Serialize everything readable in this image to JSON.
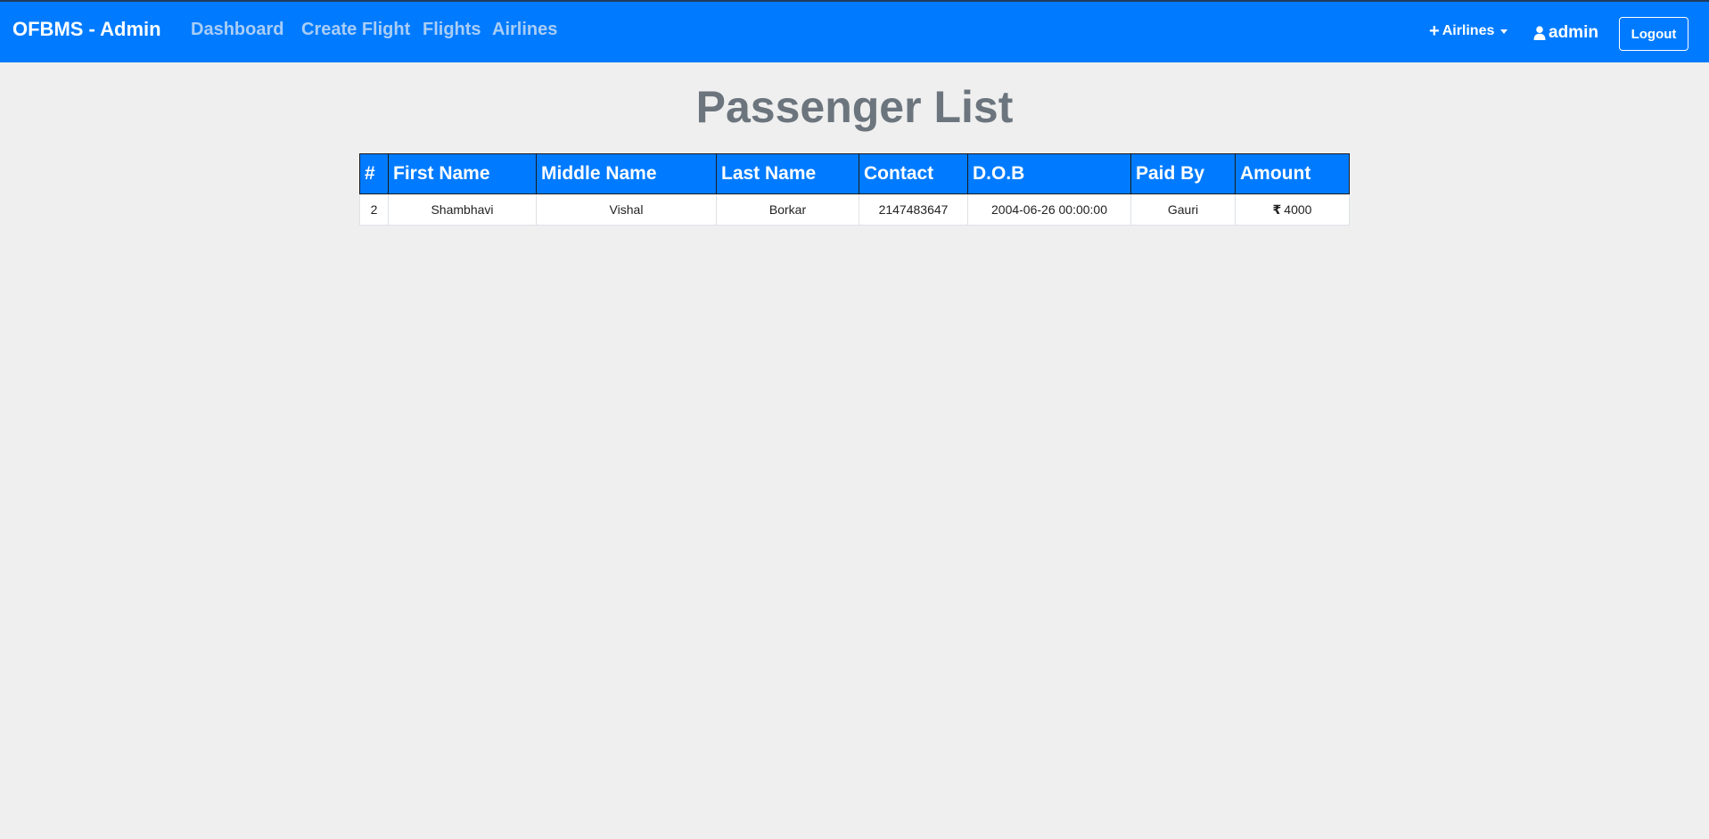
{
  "navbar": {
    "brand": "OFBMS - Admin",
    "links": [
      "Dashboard",
      "Create Flight",
      "Flights",
      "Airlines"
    ],
    "airlines_dropdown": {
      "icon": "plus-icon",
      "label": "Airlines"
    },
    "user": {
      "icon": "user-icon",
      "label": "admin"
    },
    "logout_label": "Logout",
    "colors": {
      "background": "#007bff",
      "link_muted": "#a9cdf6"
    }
  },
  "page": {
    "title": "Passenger List",
    "title_color": "#6c757d"
  },
  "table": {
    "columns": [
      "#",
      "First Name",
      "Middle Name",
      "Last Name",
      "Contact",
      "D.O.B",
      "Paid By",
      "Amount"
    ],
    "rows": [
      {
        "id": "2",
        "first_name": "Shambhavi",
        "middle_name": "Vishal",
        "last_name": "Borkar",
        "contact": "2147483647",
        "dob": "2004-06-26 00:00:00",
        "paid_by": "Gauri",
        "currency_symbol": "₹",
        "amount": "4000"
      }
    ]
  }
}
